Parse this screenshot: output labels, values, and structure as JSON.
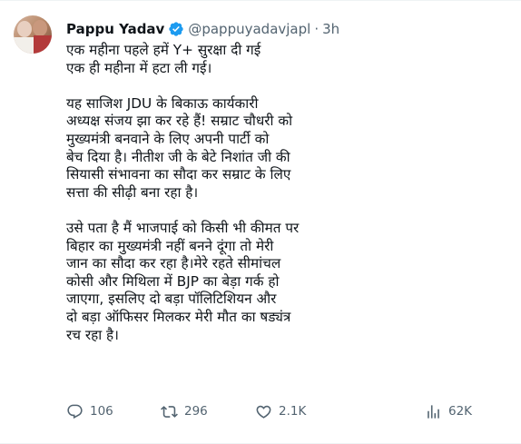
{
  "tweet": {
    "author_name": "Pappu Yadav",
    "handle": "@pappuyadavjapl",
    "separator": "·",
    "time": "3h",
    "lines": [
      "एक महीना पहले हमें Y+ सुरक्षा दी गई",
      "एक ही महीना में हटा ली गई।",
      "",
      "यह साजिश JDU के बिकाऊ कार्यकारी",
      "अध्यक्ष संजय झा कर रहे हैं! सम्राट चौधरी को",
      "मुख्यमंत्री बनवाने के लिए अपनी पार्टी को",
      "बेच दिया है। नीतीश जी के बेटे निशांत जी की",
      "सियासी संभावना का सौदा कर सम्राट के लिए",
      "सत्ता की सीढ़ी बना रहा है।",
      "",
      "उसे पता है मैं भाजपाई को किसी भी कीमत पर",
      "बिहार का मुख्यमंत्री नहीं बनने दूंगा तो मेरी",
      "जान का सौदा कर रहा है।मेरे रहते सीमांचल",
      "कोसी और मिथिला में BJP का बेड़ा गर्क हो",
      "जाएगा, इसलिए दो बड़ा पॉलिटिशियन और",
      "दो बड़ा ऑफिसर मिलकर मेरी मौत का षड्यंत्र",
      "रच रहा है।"
    ],
    "stats": {
      "replies": "106",
      "retweets": "296",
      "likes": "2.1K",
      "views": "62K"
    }
  },
  "colors": {
    "text": "#0f1419",
    "muted": "#536471",
    "verified": "#1d9bf0"
  },
  "icons": [
    "verified-badge-icon",
    "reply-icon",
    "retweet-icon",
    "like-icon",
    "views-icon"
  ]
}
